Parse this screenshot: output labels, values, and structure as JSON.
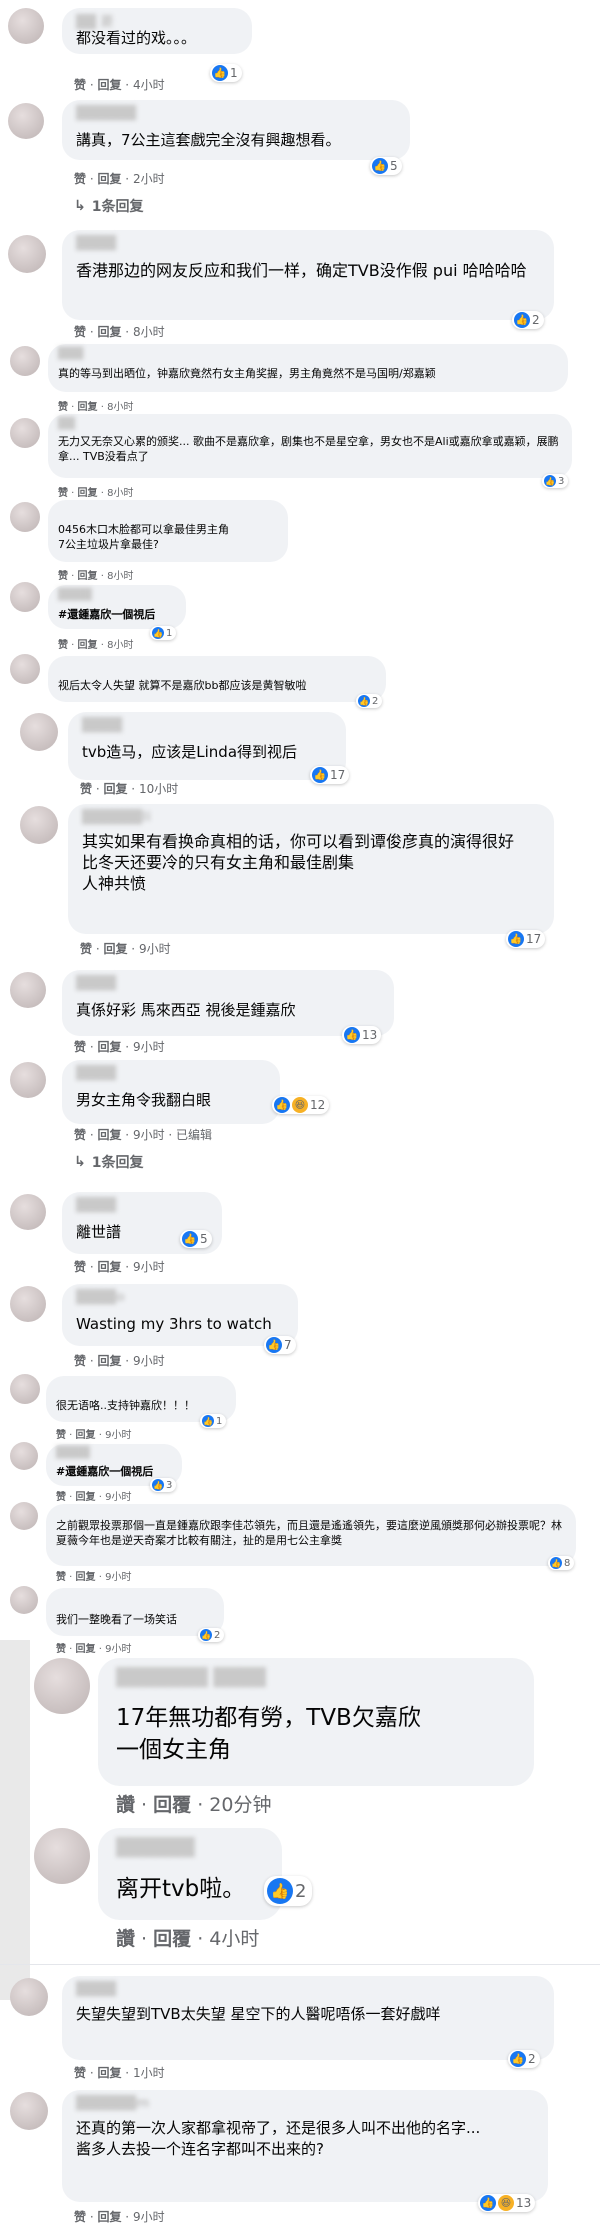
{
  "actions": {
    "like": "赞",
    "reply": "回复",
    "like_trad": "讚",
    "reply_trad": "回覆"
  },
  "comments": [
    {
      "text": "都没看过的戏。。。",
      "time": "4小时",
      "reactions": "1"
    },
    {
      "text": "講真，7公主這套戲完全沒有興趣想看。",
      "time": "2小时",
      "reactions": "5",
      "replies": "1条回复"
    },
    {
      "text": "香港那边的网友反应和我们一样，确定TVB没作假 pui 哈哈哈哈",
      "time": "8小时",
      "reactions": "2"
    },
    {
      "text": "真的等马到出晒位，钟嘉欣竟然冇女主角奖握，男主角竟然不是马国明/郑嘉颖",
      "time": "8小时"
    },
    {
      "text": "无力又无奈又心累的颁奖... 歌曲不是嘉欣拿，剧集也不是星空拿，男女也不是Ali或嘉欣拿或嘉颖，展鹏拿... TVB没看点了",
      "time": "8小时",
      "reactions": "3"
    },
    {
      "text": "0456木口木脸都可以拿最佳男主角\n7公主垃圾片拿最佳?",
      "time": "8小时"
    },
    {
      "text": "#還鍾嘉欣一個視后",
      "time": "8小时",
      "reactions": "1"
    },
    {
      "text": "视后太令人失望 就算不是嘉欣bb都应该是黄智敏啦",
      "time": "8小时",
      "reactions": "2"
    },
    {
      "text": "tvb造马，应该是Linda得到视后",
      "time": "10小时",
      "reactions": "17"
    },
    {
      "text": "其实如果有看换命真相的话，你可以看到谭俊彦真的演得很好\n比冬天还要冷的只有女主角和最佳剧集\n人神共愤",
      "time": "9小时",
      "reactions": "17"
    },
    {
      "text": "真係好彩 馬來西亞 視後是鍾嘉欣",
      "time": "9小时",
      "reactions": "13"
    },
    {
      "text": "男女主角令我翻白眼",
      "time": "9小时",
      "edited": "已编辑",
      "reactions": "12",
      "replies": "1条回复"
    },
    {
      "text": "離世譜",
      "time": "9小时",
      "reactions": "5"
    },
    {
      "text": "Wasting my 3hrs to watch",
      "time": "9小时",
      "reactions": "7"
    },
    {
      "text": "很无语咯..支持钟嘉欣！！！",
      "time": "9小时",
      "reactions": "1"
    },
    {
      "text": "#還鍾嘉欣一個視后",
      "time": "9小时",
      "reactions": "3"
    },
    {
      "text": "之前觀眾投票那個一直是鍾嘉欣跟李佳芯領先，而且還是遙遙領先，要這麼逆風頒獎那何必辦投票呢？林夏薇今年也是逆天奇案才比較有關注，扯的是用七公主拿獎",
      "time": "9小时",
      "reactions": "8"
    },
    {
      "text": "我们一整晚看了一场笑话",
      "time": "9小时",
      "reactions": "2"
    },
    {
      "text": "17年無功都有勞，TVB欠嘉欣一個女主角",
      "time": "20分钟"
    },
    {
      "text": "离开tvb啦。",
      "time": "4小时",
      "reactions": "2"
    },
    {
      "text": "失望失望到TVB太失望 星空下的人醫呢唔係一套好戲咩",
      "time": "1小时",
      "reactions": "2"
    },
    {
      "text": "还真的第一次人家都拿视帝了，还是很多人叫不出他的名字...\n酱多人去投一个连名字都叫不出来的?",
      "time": "9小时",
      "reactions": "13"
    }
  ],
  "colors": {
    "like_blue": "#1877f2",
    "bubble_bg": "#f0f2f5",
    "meta_gray": "#65676b",
    "emoji_yellow": "#f7b125"
  }
}
